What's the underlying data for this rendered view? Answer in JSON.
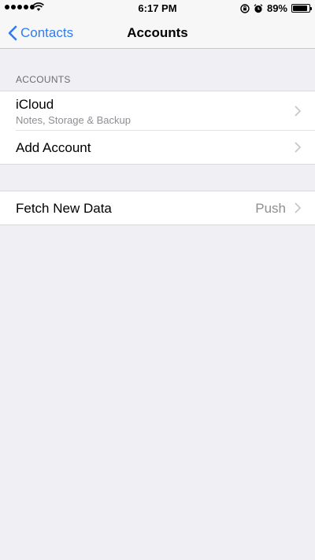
{
  "status_bar": {
    "time": "6:17 PM",
    "battery_percent": "89%",
    "battery_level": 0.89,
    "signal_icon": "signal-dots-icon",
    "wifi_icon": "wifi-icon",
    "lock_icon": "rotation-lock-icon",
    "alarm_icon": "alarm-icon"
  },
  "nav": {
    "back_label": "Contacts",
    "title": "Accounts"
  },
  "accounts_section": {
    "header": "ACCOUNTS",
    "items": [
      {
        "title": "iCloud",
        "subtitle": "Notes, Storage & Backup"
      },
      {
        "title": "Add Account"
      }
    ]
  },
  "fetch_section": {
    "title": "Fetch New Data",
    "value": "Push"
  },
  "colors": {
    "accent": "#2e7cf6",
    "background": "#efeff4",
    "secondary_text": "#8e8e93"
  }
}
